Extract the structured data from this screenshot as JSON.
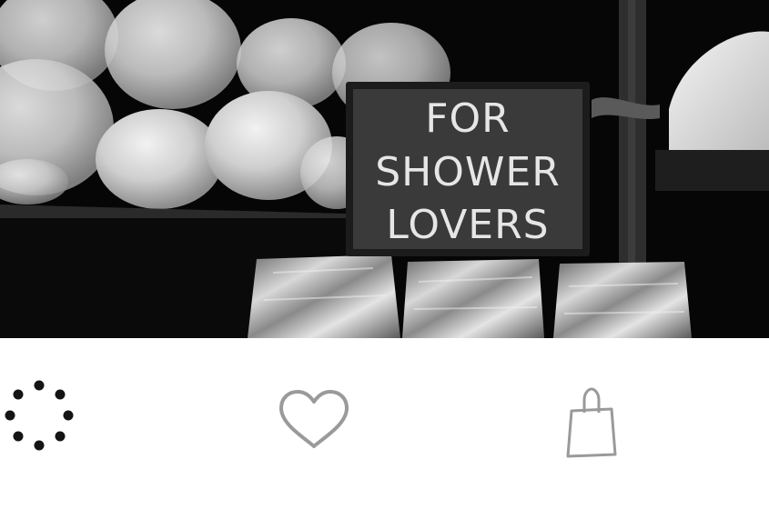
{
  "hero": {
    "sign_lines": [
      "FOR",
      "SHOWER",
      "LOVERS"
    ]
  },
  "actions": {
    "loading": {
      "icon": "spinner-dots-icon"
    },
    "favorite": {
      "icon": "heart-outline-icon"
    },
    "shop": {
      "icon": "shopping-bag-icon"
    }
  },
  "colors": {
    "background": "#ffffff",
    "spinner": "#141414",
    "icon_stroke": "#9a9a9a",
    "sign_board": "#3a3a3a"
  }
}
